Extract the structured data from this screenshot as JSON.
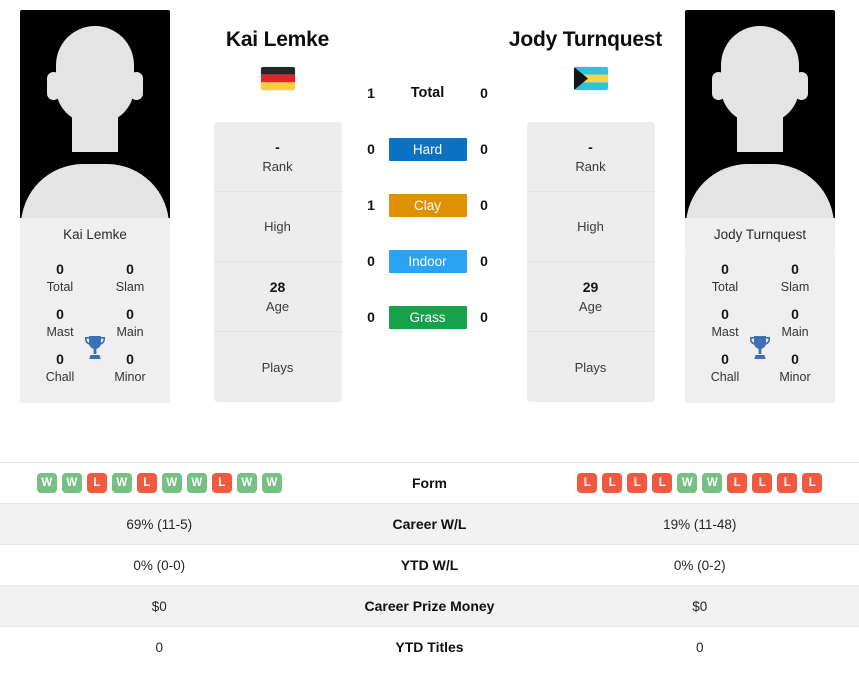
{
  "players": {
    "left": {
      "name": "Kai Lemke",
      "photo_name": "Kai Lemke",
      "flag": "germany-flag",
      "titles": {
        "total_value": "0",
        "total_label": "Total",
        "slam_value": "0",
        "slam_label": "Slam",
        "mast_value": "0",
        "mast_label": "Mast",
        "main_value": "0",
        "main_label": "Main",
        "chall_value": "0",
        "chall_label": "Chall",
        "minor_value": "0",
        "minor_label": "Minor"
      },
      "info": {
        "rank_value": "-",
        "rank_label": "Rank",
        "high_value": "",
        "high_label": "High",
        "age_value": "28",
        "age_label": "Age",
        "plays_value": "",
        "plays_label": "Plays"
      },
      "h2h": {
        "total": "1",
        "hard": "0",
        "clay": "1",
        "indoor": "0",
        "grass": "0"
      },
      "form": [
        "W",
        "W",
        "L",
        "W",
        "L",
        "W",
        "W",
        "L",
        "W",
        "W"
      ],
      "career_wl": "69% (11-5)",
      "ytd_wl": "0% (0-0)",
      "career_prize": "$0",
      "ytd_titles": "0"
    },
    "right": {
      "name": "Jody Turnquest",
      "photo_name": "Jody Turnquest",
      "flag": "bahamas-flag",
      "titles": {
        "total_value": "0",
        "total_label": "Total",
        "slam_value": "0",
        "slam_label": "Slam",
        "mast_value": "0",
        "mast_label": "Mast",
        "main_value": "0",
        "main_label": "Main",
        "chall_value": "0",
        "chall_label": "Chall",
        "minor_value": "0",
        "minor_label": "Minor"
      },
      "info": {
        "rank_value": "-",
        "rank_label": "Rank",
        "high_value": "",
        "high_label": "High",
        "age_value": "29",
        "age_label": "Age",
        "plays_value": "",
        "plays_label": "Plays"
      },
      "h2h": {
        "total": "0",
        "hard": "0",
        "clay": "0",
        "indoor": "0",
        "grass": "0"
      },
      "form": [
        "L",
        "L",
        "L",
        "L",
        "W",
        "W",
        "L",
        "L",
        "L",
        "L"
      ],
      "career_wl": "19% (11-48)",
      "ytd_wl": "0% (0-2)",
      "career_prize": "$0",
      "ytd_titles": "0"
    }
  },
  "surfaces": {
    "total_label": "Total",
    "hard_label": "Hard",
    "clay_label": "Clay",
    "indoor_label": "Indoor",
    "grass_label": "Grass",
    "colors": {
      "hard": "#0b72c4",
      "clay": "#dd9103",
      "indoor": "#29a3f5",
      "grass": "#16a24a"
    }
  },
  "table": {
    "form_label": "Form",
    "career_wl_label": "Career W/L",
    "ytd_wl_label": "YTD W/L",
    "career_prize_label": "Career Prize Money",
    "ytd_titles_label": "YTD Titles"
  },
  "colors": {
    "win": "#76c083",
    "loss": "#f05a41",
    "card_bg": "#ededed",
    "row_shade": "#f2f2f2",
    "trophy": "#3d6fb4"
  }
}
